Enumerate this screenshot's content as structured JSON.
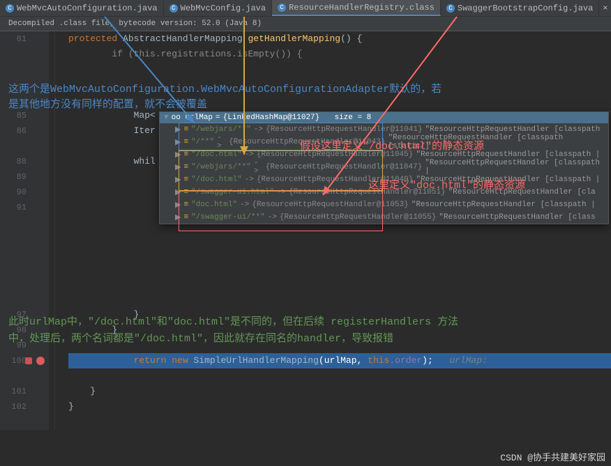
{
  "tabs": [
    {
      "icon": "C",
      "label": "WebMvcAutoConfiguration.java"
    },
    {
      "icon": "C",
      "label": "WebMvcConfig.java"
    },
    {
      "icon": "C",
      "label": "ResourceHandlerRegistry.class"
    },
    {
      "icon": "C",
      "label": "SwaggerBootstrapConfig.java"
    }
  ],
  "notice": "Decompiled .class file, bytecode version: 52.0 (Java 8)",
  "gutter": [
    "81",
    "",
    "",
    "",
    "",
    "85",
    "86",
    "",
    "88",
    "89",
    "90",
    "91",
    "",
    "",
    "",
    "",
    "",
    "",
    "97",
    "98",
    "99",
    "100",
    "",
    "101",
    "102",
    ""
  ],
  "code": {
    "l0": "    protected AbstractHandlerMapping getHandlerMapping() {",
    "l0_kw": "protected",
    "l0_type": "AbstractHandlerMapping",
    "l0_method": "getHandlerMapping",
    "l1": "        if (this.registrations.isEmpty()) {",
    "l5": "            Map<",
    "l6": "            Iter",
    "l8": "            whil",
    "l18a": "            }",
    "l19a": "        }",
    "l21_kw1": "return",
    "l21_kw2": "new",
    "l21_type": "SimpleUrlHandlerMapping",
    "l21_arg1": "urlMap",
    "l21_kw3": "this",
    "l21_field": ".order",
    "l21_cmt": "urlMap:",
    "l24": "    }",
    "l25": "}"
  },
  "popup": {
    "header_var": "oo urlMap",
    "header_ref": "{LinkedHashMap@11027}",
    "header_size": "size = 8",
    "rows": [
      {
        "key": "\"/webjars/**\"",
        "ref": "{ResourceHttpRequestHandler@11041}",
        "val": "\"ResourceHttpRequestHandler [classpath"
      },
      {
        "key": "\"/**\"",
        "ref": "{ResourceHttpRequestHandler@11043}",
        "val": "\"ResourceHttpRequestHandler [classpath [static/]"
      },
      {
        "key": "\"/doc.html\"",
        "ref": "{ResourceHttpRequestHandler@11045}",
        "val": "\"ResourceHttpRequestHandler [classpath |"
      },
      {
        "key": "\"/webjars/**\"",
        "ref": "{ResourceHttpRequestHandler@11047}",
        "val": "\"ResourceHttpRequestHandler [classpath |"
      },
      {
        "key": "\"/doc.html\"",
        "ref": "{ResourceHttpRequestHandler@11049}",
        "val": "\"ResourceHttpRequestHandler [classpath |"
      },
      {
        "key": "\"/swagger-ui.html\"",
        "ref": "{ResourceHttpRequestHandler@11051}",
        "val": "\"ResourceHttpRequestHandler [cla"
      },
      {
        "key": "\"doc.html\"",
        "ref": "{ResourceHttpRequestHandler@11053}",
        "val": "\"ResourceHttpRequestHandler [classpath |"
      },
      {
        "key": "\"/swagger-ui/**\"",
        "ref": "{ResourceHttpRequestHandler@11055}",
        "val": "\"ResourceHttpRequestHandler [class"
      }
    ]
  },
  "annotations": {
    "blue1": "这两个是WebMvcAutoConfiguration.WebMvcAutoConfigurationAdapter默认的，若",
    "blue2": "是其他地方没有同样的配置，就不会被覆盖",
    "red1": "假设这里定义\"/doc.html\"的静态资源",
    "red2": "这里定义\"doc.html\"的静态资源",
    "green1": "此时urlMap中，\"/doc.html\"和\"doc.html\"是不同的，但在后续   registerHandlers   方法",
    "green2": "中，处理后，两个名词都是\"/doc.html\"，因此就存在同名的handler，导致报错"
  },
  "watermark": "CSDN @协手共建美好家园"
}
